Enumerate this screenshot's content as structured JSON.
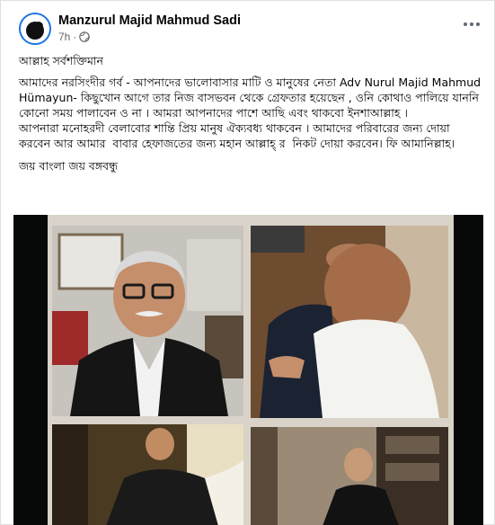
{
  "post": {
    "author": "Manzurul Majid Mahmud Sadi",
    "time": "7h",
    "dot": "·",
    "privacy_icon": "globe-icon",
    "menu_icon": "more-options-icon",
    "greeting": "আল্লাহ সর্বশক্তিমান",
    "body": "আমাদের নরসিংদীর গর্ব - আপনাদের ভালোবাসার মাটি ও মানুষের নেতা Adv Nurul Majid Mahmud Hümayun- কিছুখোন আগে তার নিজ বাসভবন থেকে গ্রেফতার হয়েছেন , ওনি কোথাও পালিয়ে যাননি কোনো সময় পালাবেন ও না । আমরা আপনাদের পাশে আছি এবং থাকবো ইনশাআল্লাহ ।\nআপনারা মনোহরদী বেলাবোর শান্তি প্রিয় মানুষ ঐক্যবধ্য থাকবেন । আমাদের পরিবারের জন্য দোয়া করবেন আর আমার  বাবার হেফাজতের জন্য মহান আল্লাহ্‌ র  নিকট দোয়া করবেন। ফি আমানিল্লাহ।",
    "slogan": "জয় বাংলা জয় বঙ্গবন্ধু"
  },
  "colors": {
    "text": "#050505",
    "secondary": "#65676b",
    "avatar_ring": "#1b74e4",
    "media_bg": "#070808"
  }
}
